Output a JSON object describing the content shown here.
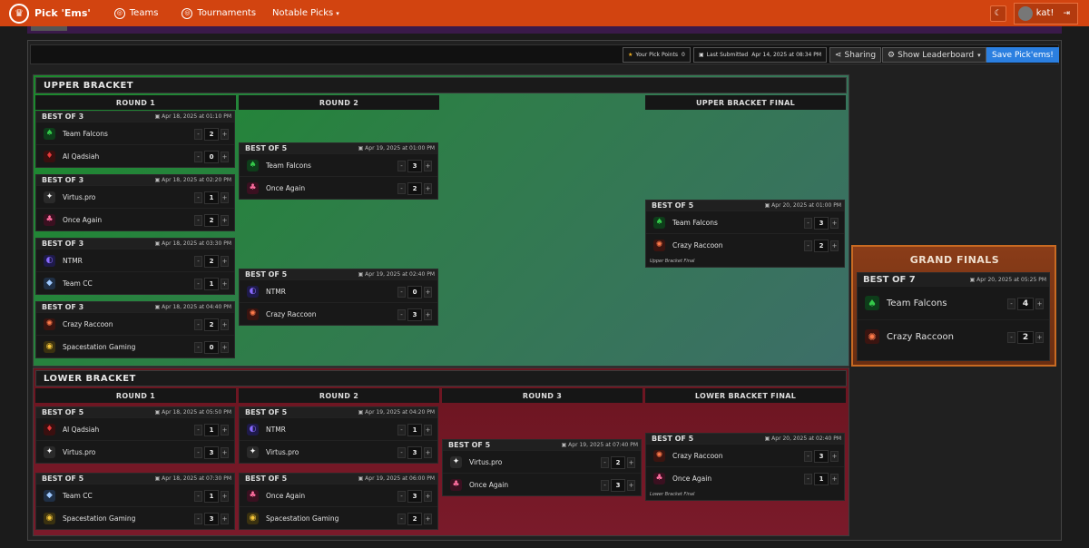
{
  "nav": {
    "brand": "Pick 'Ems'",
    "links": [
      {
        "label": "Teams"
      },
      {
        "label": "Tournaments"
      }
    ],
    "notable": "Notable Picks",
    "user": "kat!"
  },
  "toolbar": {
    "points_label": "Your Pick Points",
    "points_value": "0",
    "submitted_label": "Last Submitted",
    "submitted_value": "Apr 14, 2025 at 08:34 PM",
    "sharing": "Sharing",
    "leaderboard": "Show Leaderboard",
    "save": "Save Pick'ems!"
  },
  "upper": {
    "title": "UPPER BRACKET",
    "rounds": [
      "ROUND 1",
      "ROUND 2",
      "UPPER BRACKET FINAL"
    ],
    "final_caption": "Upper Bracket Final",
    "r1": [
      {
        "bo": "BEST OF 3",
        "date": "Apr 18, 2025 at 01:10 PM",
        "t1": "Team Falcons",
        "s1": "2",
        "t2": "Al Qadsiah",
        "s2": "0"
      },
      {
        "bo": "BEST OF 3",
        "date": "Apr 18, 2025 at 02:20 PM",
        "t1": "Virtus.pro",
        "s1": "1",
        "t2": "Once Again",
        "s2": "2"
      },
      {
        "bo": "BEST OF 3",
        "date": "Apr 18, 2025 at 03:30 PM",
        "t1": "NTMR",
        "s1": "2",
        "t2": "Team CC",
        "s2": "1"
      },
      {
        "bo": "BEST OF 3",
        "date": "Apr 18, 2025 at 04:40 PM",
        "t1": "Crazy Raccoon",
        "s1": "2",
        "t2": "Spacestation Gaming",
        "s2": "0"
      }
    ],
    "r2": [
      {
        "bo": "BEST OF 5",
        "date": "Apr 19, 2025 at 01:00 PM",
        "t1": "Team Falcons",
        "s1": "3",
        "t2": "Once Again",
        "s2": "2"
      },
      {
        "bo": "BEST OF 5",
        "date": "Apr 19, 2025 at 02:40 PM",
        "t1": "NTMR",
        "s1": "0",
        "t2": "Crazy Raccoon",
        "s2": "3"
      }
    ],
    "final": {
      "bo": "BEST OF 5",
      "date": "Apr 20, 2025 at 01:00 PM",
      "t1": "Team Falcons",
      "s1": "3",
      "t2": "Crazy Raccoon",
      "s2": "2"
    }
  },
  "lower": {
    "title": "LOWER BRACKET",
    "rounds": [
      "ROUND 1",
      "ROUND 2",
      "ROUND 3",
      "LOWER BRACKET FINAL"
    ],
    "final_caption": "Lower Bracket Final",
    "r1": [
      {
        "bo": "BEST OF 5",
        "date": "Apr 18, 2025 at 05:50 PM",
        "t1": "Al Qadsiah",
        "s1": "1",
        "t2": "Virtus.pro",
        "s2": "3"
      },
      {
        "bo": "BEST OF 5",
        "date": "Apr 18, 2025 at 07:30 PM",
        "t1": "Team CC",
        "s1": "1",
        "t2": "Spacestation Gaming",
        "s2": "3"
      }
    ],
    "r2": [
      {
        "bo": "BEST OF 5",
        "date": "Apr 19, 2025 at 04:20 PM",
        "t1": "NTMR",
        "s1": "1",
        "t2": "Virtus.pro",
        "s2": "3"
      },
      {
        "bo": "BEST OF 5",
        "date": "Apr 19, 2025 at 06:00 PM",
        "t1": "Once Again",
        "s1": "3",
        "t2": "Spacestation Gaming",
        "s2": "2"
      }
    ],
    "r3": [
      {
        "bo": "BEST OF 5",
        "date": "Apr 19, 2025 at 07:40 PM",
        "t1": "Virtus.pro",
        "s1": "2",
        "t2": "Once Again",
        "s2": "3"
      }
    ],
    "final": {
      "bo": "BEST OF 5",
      "date": "Apr 20, 2025 at 02:40 PM",
      "t1": "Crazy Raccoon",
      "s1": "3",
      "t2": "Once Again",
      "s2": "1"
    }
  },
  "grand": {
    "title": "GRAND FINALS",
    "bo": "BEST OF 7",
    "date": "Apr 20, 2025 at 05:25 PM",
    "t1": "Team Falcons",
    "s1": "4",
    "t2": "Crazy Raccoon",
    "s2": "2"
  },
  "icons": {
    "Team Falcons": "falcon-icon",
    "Al Qadsiah": "al-qadsiah-icon",
    "Virtus.pro": "virtus-pro-icon",
    "Once Again": "once-again-icon",
    "NTMR": "ntmr-icon",
    "Team CC": "team-cc-icon",
    "Crazy Raccoon": "crazy-raccoon-icon",
    "Spacestation Gaming": "spacestation-icon"
  }
}
